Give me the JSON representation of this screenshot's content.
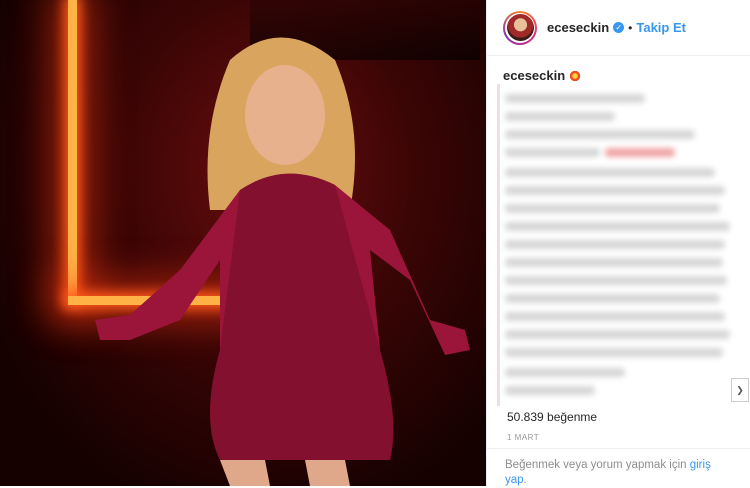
{
  "post": {
    "username": "eceseckin",
    "follow_label": "Takip Et",
    "dot": "•",
    "likes": "50.839 beğenme",
    "date": "1 MART",
    "login_prefix": "Beğenmek veya yorum yapmak için",
    "login_link": "giriş yap",
    "login_suffix": "."
  },
  "icons": {
    "verified": "verified-badge-icon",
    "caption_emoji": "collision-emoji-icon",
    "scroll": "chevron-icon"
  },
  "colors": {
    "link": "#3897f0",
    "neon": "#ff5a1a"
  }
}
